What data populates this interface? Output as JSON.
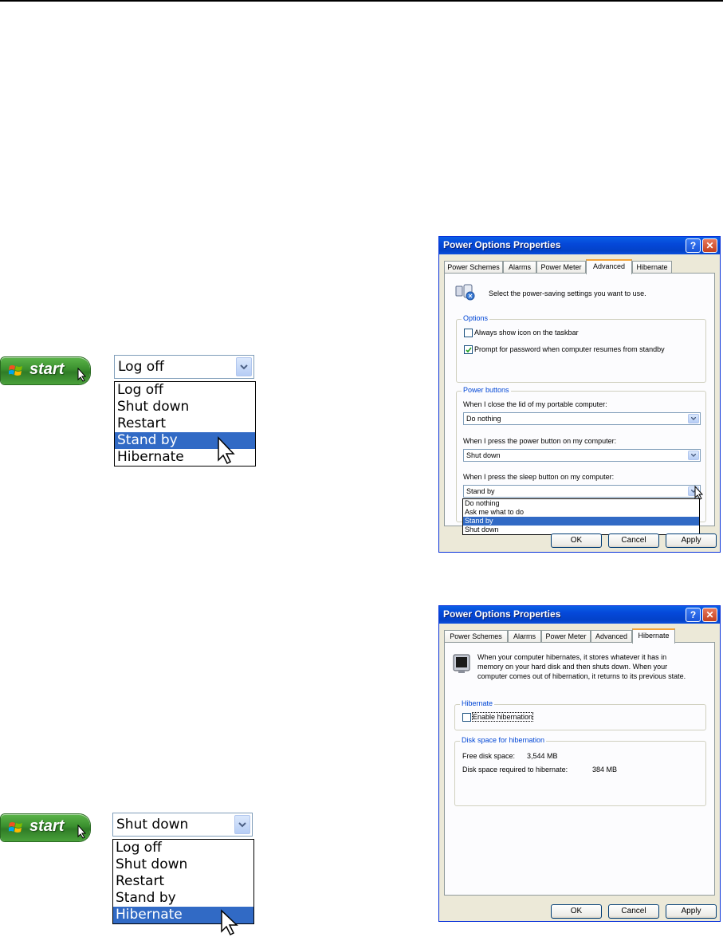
{
  "start_button": {
    "label": "start"
  },
  "shutdown_menu_1": {
    "selected": "Log off",
    "options": [
      "Log off",
      "Shut down",
      "Restart",
      "Stand by",
      "Hibernate"
    ],
    "highlighted_index": 3
  },
  "shutdown_menu_2": {
    "selected": "Shut down",
    "options": [
      "Log off",
      "Shut down",
      "Restart",
      "Stand by",
      "Hibernate"
    ],
    "highlighted_index": 4
  },
  "dialog_advanced": {
    "title": "Power Options Properties",
    "help_glyph": "?",
    "close_glyph": "✕",
    "tabs": [
      "Power Schemes",
      "Alarms",
      "Power Meter",
      "Advanced",
      "Hibernate"
    ],
    "active_tab": "Advanced",
    "intro": "Select the power-saving settings you want to use.",
    "options_group": "Options",
    "checkbox_1": {
      "label": "Always show icon on the taskbar",
      "checked": false
    },
    "checkbox_2": {
      "label": "Prompt for password when computer resumes from standby",
      "checked": true
    },
    "power_buttons_group": "Power buttons",
    "lid_label": "When I close the lid of my portable computer:",
    "lid_value": "Do nothing",
    "power_label": "When I press the power button on my computer:",
    "power_value": "Shut down",
    "sleep_label": "When I press the sleep button on my computer:",
    "sleep_value": "Stand by",
    "sleep_options": [
      "Do nothing",
      "Ask me what to do",
      "Stand by",
      "Shut down"
    ],
    "sleep_highlighted_index": 2,
    "ok": "OK",
    "cancel": "Cancel",
    "apply": "Apply"
  },
  "dialog_hibernate": {
    "title": "Power Options Properties",
    "help_glyph": "?",
    "close_glyph": "✕",
    "tabs": [
      "Power Schemes",
      "Alarms",
      "Power Meter",
      "Advanced",
      "Hibernate"
    ],
    "active_tab": "Hibernate",
    "intro_line_1": "When your computer hibernates, it stores whatever it has in",
    "intro_line_2": "memory on your hard disk and then shuts down. When your",
    "intro_line_3": "computer comes out of hibernation, it returns to its previous state.",
    "hibernate_group": "Hibernate",
    "enable_label": "Enable hibernation",
    "enable_checked": false,
    "disk_group": "Disk space for hibernation",
    "free_label": "Free disk space:",
    "free_value": "3,544 MB",
    "required_label": "Disk space required to hibernate:",
    "required_value": "384 MB",
    "ok": "OK",
    "cancel": "Cancel",
    "apply": "Apply"
  }
}
